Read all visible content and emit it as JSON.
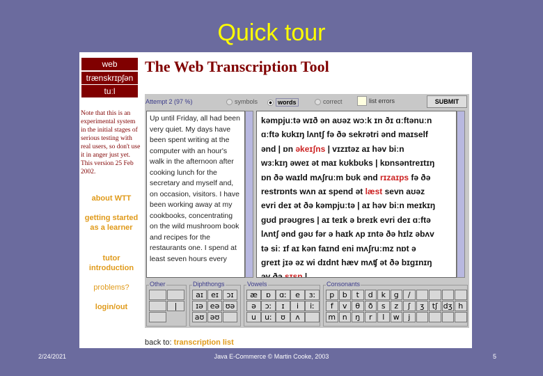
{
  "slide": {
    "title": "Quick tour",
    "footer_date": "2/24/2021",
    "footer_center": "Java E-Commerce © Martin Cooke, 2003",
    "page_number": "5"
  },
  "logo": {
    "line1": "web",
    "line2": "trænskrɪpʃən",
    "line3": "tuːl"
  },
  "note": "Note that this is an experimental system in the initial stages of serious testing with real users, so don't use it in anger just yet. This version 25 Feb 2002.",
  "nav": [
    "about WTT",
    "getting started as a learner",
    "tutor introduction",
    "problems?",
    "login/out"
  ],
  "app": {
    "title": "The Web Transcription Tool",
    "attempt": "Attempt 2 (97 %)",
    "modes": [
      {
        "label": "symbols",
        "selected": false
      },
      {
        "label": "words",
        "selected": true
      },
      {
        "label": "correct",
        "selected": false
      }
    ],
    "list_errors": {
      "label": "list errors",
      "checked": false
    },
    "submit": "SUBMIT",
    "source_text": "Up until Friday, all had been very quiet. My days have been spent writing at the computer with an hour's walk in the afternoon after cooking lunch for the secretary and myself and, on occasion, visitors. I have been working away at my cookbooks, concentrating on the wild mushroom book and recipes for the restaurants one. I spend at least seven hours every",
    "transcription": [
      [
        {
          "t": "kəmpjuːtə wɪð ən aʊəz wɔːk ɪn ðɪ ɑːftənuːn"
        }
      ],
      [
        {
          "t": "ɑːftə kʊkɪŋ lʌntʃ fə ðə sekrətri ənd maɪself"
        }
      ],
      [
        {
          "t": "ənd | ɒn "
        },
        {
          "t": "əkeɪʃns",
          "err": true
        },
        {
          "t": " | vɪzɪtəz  aɪ həv biːn"
        }
      ],
      [
        {
          "t": "wɜːkɪŋ əweɪ ət maɪ kʊkbʊks | kɒnsəntreɪtɪŋ"
        }
      ],
      [
        {
          "t": "ɒn ðə waɪld mʌʃruːm bʊk ənd "
        },
        {
          "t": "rɪzaɪps",
          "err": true
        },
        {
          "t": " fə ðə"
        }
      ],
      [
        {
          "t": "restrɒnts wʌn  aɪ spend ət "
        },
        {
          "t": "læst",
          "err": true
        },
        {
          "t": " sevn aʊəz"
        }
      ],
      [
        {
          "t": "evri deɪ ət ðə kəmpjuːtə | aɪ həv biːn meɪkɪŋ"
        }
      ],
      [
        {
          "t": "gʊd prəʊgres | aɪ teɪk ə breɪk evri deɪ ɑːftə"
        }
      ],
      [
        {
          "t": "lʌntʃ ənd gəʊ fər ə haɪk ʌp ɪntə ðə hɪlz əbʌv"
        }
      ],
      [
        {
          "t": "tə siː ɪf aɪ kən faɪnd eni mʌʃruːmz  nɒt ə"
        }
      ],
      [
        {
          "t": "greɪt jɪə əz wi dɪdnt hæv mʌʧ ət ðə bɪgɪnɪŋ"
        }
      ],
      [
        {
          "t": "əv ðə "
        },
        {
          "t": "sɪsn",
          "err": true
        },
        {
          "t": " |"
        }
      ]
    ],
    "keyboard": {
      "other": {
        "label": "Other",
        "keys": [
          "",
          "",
          "",
          "|",
          ""
        ]
      },
      "diphthongs": {
        "label": "Diphthongs",
        "keys": [
          "aɪ",
          "eɪ",
          "ɔɪ",
          "ɪə",
          "eə",
          "ʊə",
          "aʊ",
          "əʊ",
          ""
        ]
      },
      "vowels": {
        "label": "Vowels",
        "keys": [
          "æ",
          "ɒ",
          "ɑː",
          "e",
          "ɜː",
          "ə",
          "ɔː",
          "ɪ",
          "i",
          "iː",
          "u",
          "uː",
          "ʊ",
          "ʌ",
          ""
        ]
      },
      "consonants": {
        "label": "Consonants",
        "keys": [
          "p",
          "b",
          "t",
          "d",
          "k",
          "g",
          "/",
          "",
          "",
          "",
          "",
          "f",
          "v",
          "θ",
          "ð",
          "s",
          "z",
          "ʃ",
          "ʒ",
          "tʃ",
          "dʒ",
          "h",
          "m",
          "n",
          "ŋ",
          "r",
          "l",
          "w",
          "j",
          "",
          "",
          "",
          ""
        ]
      }
    },
    "back_prefix": "back to:",
    "back_link": "transcription list"
  }
}
